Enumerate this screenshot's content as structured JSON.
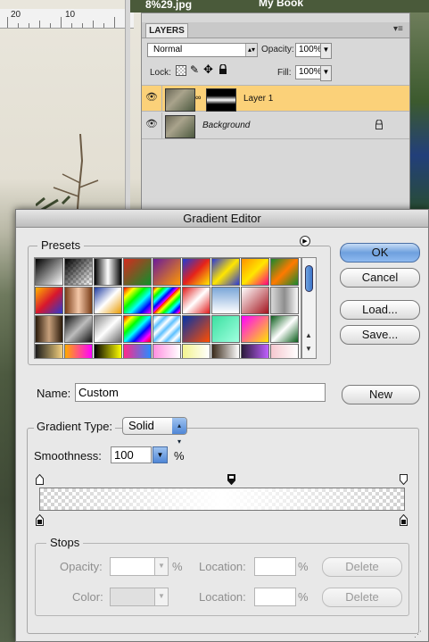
{
  "document": {
    "filename_fragment": "8%29.jpg",
    "volume_name": "My Book",
    "ruler_marks": [
      "20",
      "10"
    ]
  },
  "layers_panel": {
    "tab_label": "LAYERS",
    "menu_glyph": "▾≡",
    "blend_mode": "Normal",
    "opacity_label": "Opacity:",
    "opacity_value": "100%",
    "lock_label": "Lock:",
    "fill_label": "Fill:",
    "fill_value": "100%",
    "layers": [
      {
        "name": "Layer 1",
        "selected": true,
        "has_mask": true
      },
      {
        "name": "Background",
        "selected": false,
        "locked": true
      }
    ]
  },
  "gradient_editor": {
    "title": "Gradient Editor",
    "presets_label": "Presets",
    "buttons": {
      "ok": "OK",
      "cancel": "Cancel",
      "load": "Load...",
      "save": "Save...",
      "new": "New"
    },
    "name_label": "Name:",
    "name_value": "Custom",
    "gradient_type_label": "Gradient Type:",
    "gradient_type_value": "Solid",
    "smoothness_label": "Smoothness:",
    "smoothness_value": "100",
    "smoothness_unit": "%",
    "stops_label": "Stops",
    "stops": {
      "opacity_label": "Opacity:",
      "opacity_unit": "%",
      "location_label_1": "Location:",
      "location_unit_1": "%",
      "delete_label_1": "Delete",
      "color_label": "Color:",
      "location_label_2": "Location:",
      "location_unit_2": "%",
      "delete_label_2": "Delete"
    }
  },
  "colors": {
    "selected_layer": "#fbd179",
    "default_button": "#6ea0de",
    "dialog_bg": "#e8e8e8"
  }
}
